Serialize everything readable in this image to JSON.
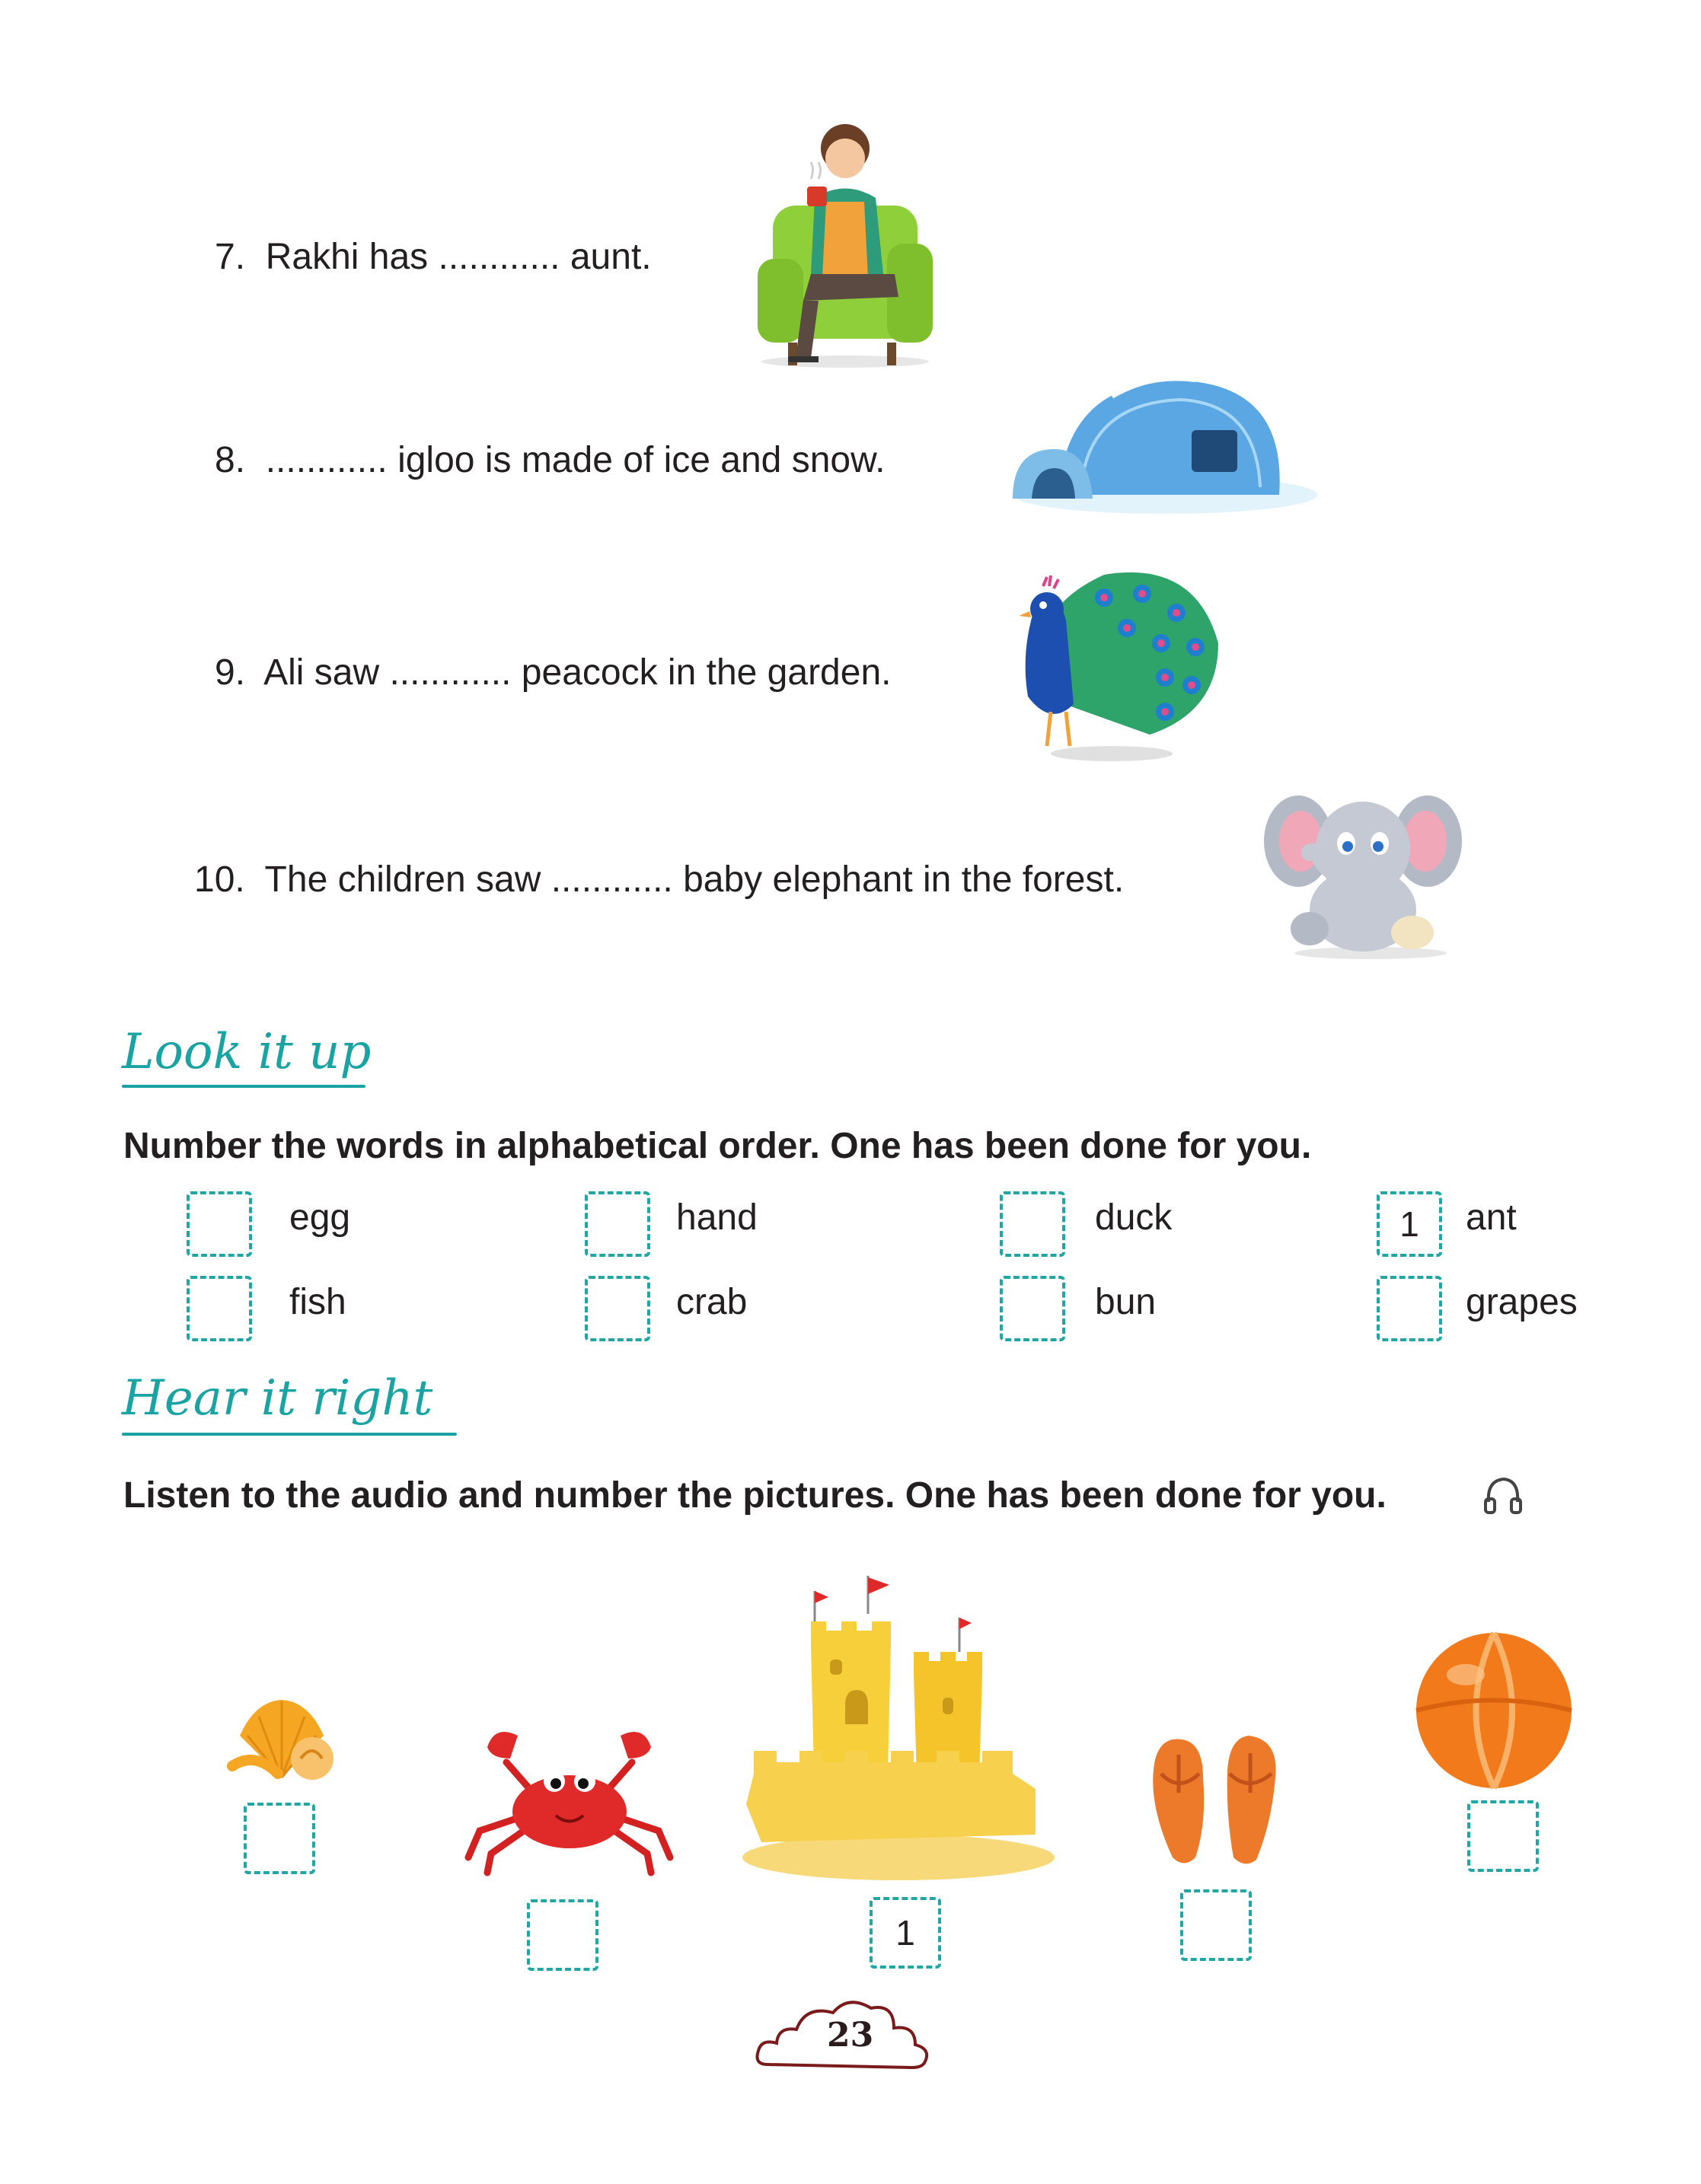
{
  "questions": [
    {
      "number": "7.",
      "text": "Rakhi has ............ aunt."
    },
    {
      "number": "8.",
      "text": "............ igloo is made of ice and snow."
    },
    {
      "number": "9.",
      "text": "Ali saw ............ peacock in the garden."
    },
    {
      "number": "10.",
      "text": "The children saw ............ baby elephant in the forest."
    }
  ],
  "look_it_up": {
    "heading": "Look it up",
    "instruction": "Number the words in alphabetical order. One has been done for you.",
    "words": [
      {
        "word": "egg",
        "value": ""
      },
      {
        "word": "hand",
        "value": ""
      },
      {
        "word": "duck",
        "value": ""
      },
      {
        "word": "ant",
        "value": "1"
      },
      {
        "word": "fish",
        "value": ""
      },
      {
        "word": "crab",
        "value": ""
      },
      {
        "word": "bun",
        "value": ""
      },
      {
        "word": "grapes",
        "value": ""
      }
    ]
  },
  "hear_it_right": {
    "heading": "Hear it right",
    "instruction": "Listen to the audio and number the pictures. One has been done for you.",
    "pictures": [
      {
        "icon": "seashell-icon",
        "value": ""
      },
      {
        "icon": "crab-icon",
        "value": ""
      },
      {
        "icon": "sandcastle-icon",
        "value": "1"
      },
      {
        "icon": "flip-flops-icon",
        "value": ""
      },
      {
        "icon": "beach-ball-icon",
        "value": ""
      }
    ]
  },
  "page_number": "23",
  "colors": {
    "accent": "#1aa3a3",
    "box_border": "#21a6a6",
    "text": "#231f20"
  }
}
